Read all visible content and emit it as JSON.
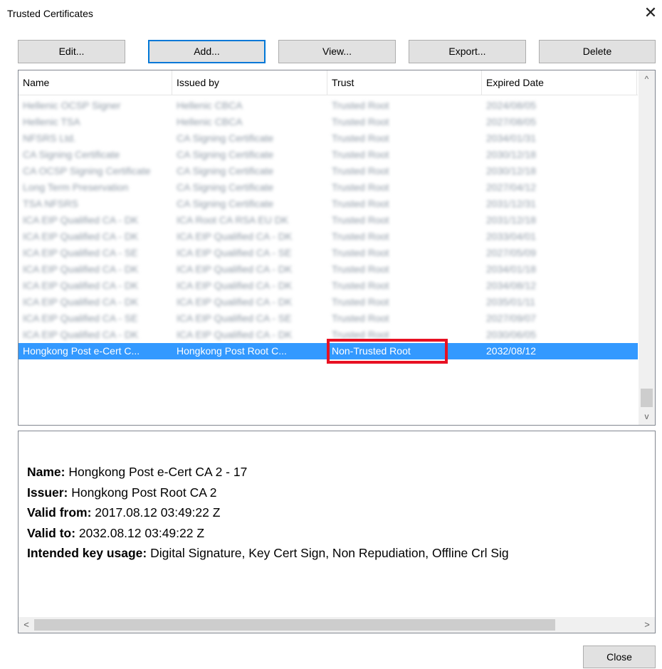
{
  "window": {
    "title": "Trusted Certificates",
    "close_glyph": "✕"
  },
  "toolbar": {
    "edit_label": "Edit...",
    "add_label": "Add...",
    "view_label": "View...",
    "export_label": "Export...",
    "delete_label": "Delete"
  },
  "list": {
    "columns": [
      "Name",
      "Issued by",
      "Trust",
      "Expired Date"
    ],
    "rows": [
      [
        "Hellenic OCSP Signer",
        "Hellenic CBCA",
        "Trusted Root",
        "2024/08/05"
      ],
      [
        "Hellenic TSA",
        "Hellenic CBCA",
        "Trusted Root",
        "2027/08/05"
      ],
      [
        "NFSRS Ltd.",
        "CA Signing Certificate",
        "Trusted Root",
        "2034/01/31"
      ],
      [
        "CA Signing Certificate",
        "CA Signing Certificate",
        "Trusted Root",
        "2030/12/18"
      ],
      [
        "CA OCSP Signing Certificate",
        "CA Signing Certificate",
        "Trusted Root",
        "2030/12/18"
      ],
      [
        "Long Term Preservation",
        "CA Signing Certificate",
        "Trusted Root",
        "2027/04/12"
      ],
      [
        "TSA NFSRS",
        "CA Signing Certificate",
        "Trusted Root",
        "2031/12/31"
      ],
      [
        "ICA EIP Qualified CA - DK",
        "ICA Root CA RSA EU DK",
        "Trusted Root",
        "2031/12/18"
      ],
      [
        "ICA EIP Qualified CA - DK",
        "ICA EIP Qualified CA - DK",
        "Trusted Root",
        "2033/04/01"
      ],
      [
        "ICA EIP Qualified CA - SE",
        "ICA EIP Qualified CA - SE",
        "Trusted Root",
        "2027/05/09"
      ],
      [
        "ICA EIP Qualified CA - DK",
        "ICA EIP Qualified CA - DK",
        "Trusted Root",
        "2034/01/18"
      ],
      [
        "ICA EIP Qualified CA - DK",
        "ICA EIP Qualified CA - DK",
        "Trusted Root",
        "2034/08/12"
      ],
      [
        "ICA EIP Qualified CA - DK",
        "ICA EIP Qualified CA - DK",
        "Trusted Root",
        "2035/01/11"
      ],
      [
        "ICA EIP Qualified CA - SE",
        "ICA EIP Qualified CA - SE",
        "Trusted Root",
        "2027/09/07"
      ],
      [
        "ICA EIP Qualified CA - DK",
        "ICA EIP Qualified CA - DK",
        "Trusted Root",
        "2030/06/05"
      ]
    ],
    "selected_row": {
      "name": "Hongkong Post e-Cert C...",
      "issued_by": "Hongkong Post Root C...",
      "trust": "Non-Trusted Root",
      "expired": "2032/08/12"
    },
    "scroll_up_glyph": "^",
    "scroll_down_glyph": "v"
  },
  "details": {
    "name_label": "Name:",
    "name_value": " Hongkong Post e-Cert CA 2 - 17",
    "issuer_label": "Issuer:",
    "issuer_value": " Hongkong Post Root CA 2",
    "valid_from_label": "Valid from:",
    "valid_from_value": " 2017.08.12 03:49:22 Z",
    "valid_to_label": "Valid to:",
    "valid_to_value": " 2032.08.12 03:49:22 Z",
    "usage_label": "Intended key usage:",
    "usage_value": " Digital Signature, Key Cert Sign, Non Repudiation, Offline Crl Sig",
    "scroll_left_glyph": "<",
    "scroll_right_glyph": ">"
  },
  "footer": {
    "close_label": "Close"
  },
  "colors": {
    "selection": "#3399ff",
    "highlight": "#e81123",
    "focus_border": "#0078d7"
  }
}
